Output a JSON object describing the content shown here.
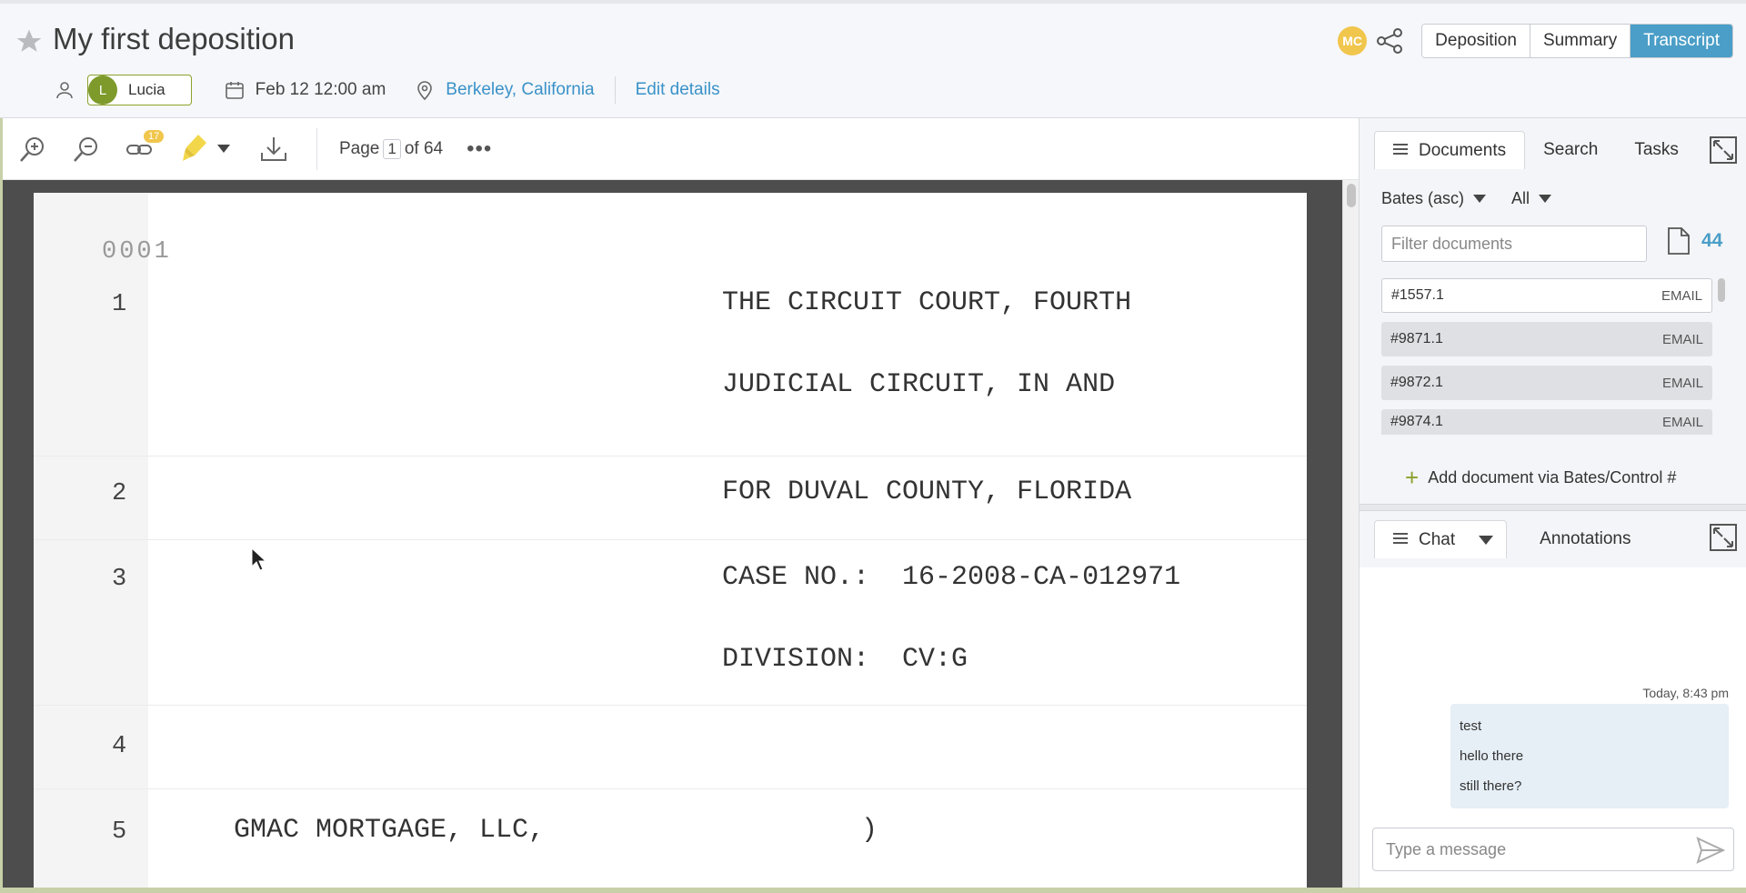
{
  "header": {
    "title": "My first deposition",
    "user": {
      "initial": "L",
      "name": "Lucia"
    },
    "date": "Feb 12 12:00 am",
    "location": "Berkeley, California",
    "edit_label": "Edit details",
    "participant_initials": "MC",
    "views": [
      "Deposition",
      "Summary",
      "Transcript"
    ],
    "active_view": "Transcript"
  },
  "toolbar": {
    "link_count": "17",
    "page_label": "Page",
    "page_current": "1",
    "page_total_label": "of 64",
    "more": "•••"
  },
  "transcript": {
    "page_number": "0001",
    "lines": [
      {
        "num": "1",
        "text": "THE CIRCUIT COURT, FOURTH"
      },
      {
        "num": "",
        "text": "JUDICIAL CIRCUIT, IN AND"
      },
      {
        "num": "2",
        "text": "FOR DUVAL COUNTY, FLORIDA"
      },
      {
        "num": "3",
        "text": "CASE NO.:  16-2008-CA-012971"
      },
      {
        "num": "",
        "text": "DIVISION:  CV:G"
      },
      {
        "num": "4",
        "text": ""
      },
      {
        "num": "5",
        "text": "GMAC MORTGAGE, LLC,",
        "right": ")"
      }
    ]
  },
  "documents_panel": {
    "tabs": [
      "Documents",
      "Search",
      "Tasks"
    ],
    "sort_label": "Bates (asc)",
    "filter_scope": "All",
    "filter_placeholder": "Filter documents",
    "doc_count": "44",
    "items": [
      {
        "id": "#1557.1",
        "kind": "EMAIL"
      },
      {
        "id": "#9871.1",
        "kind": "EMAIL"
      },
      {
        "id": "#9872.1",
        "kind": "EMAIL"
      },
      {
        "id": "#9874.1",
        "kind": "EMAIL"
      }
    ],
    "add_label": "Add document via Bates/Control #"
  },
  "chat_panel": {
    "tabs": [
      "Chat",
      "Annotations"
    ],
    "timestamp": "Today, 8:43 pm",
    "messages": [
      "test",
      "hello there",
      "still there?"
    ],
    "input_placeholder": "Type a message"
  },
  "colors": {
    "accent": "#4a9ec7",
    "user": "#7d9a2b",
    "badge": "#f1c64d",
    "highlighter": "#f3d74a"
  }
}
